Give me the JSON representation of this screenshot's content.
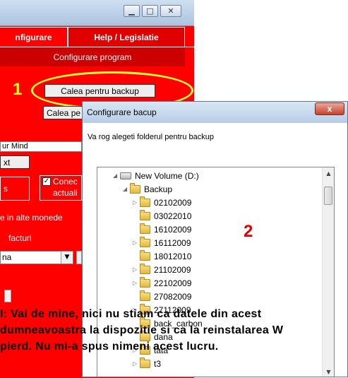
{
  "app": {
    "tabs": [
      "nfigurare",
      "Help / Legislatie"
    ],
    "config_header": "Configurare program",
    "backup_button": "Calea pentru backup",
    "backup_button_2": "Calea pe",
    "field_mind": "ur Mind",
    "btn_xt": "xt",
    "btn_s": "s",
    "checkbox_label_1": "Conec",
    "checkbox_label_2": "actuali",
    "text_monede": "e in alte monede",
    "text_facturi": "facturi",
    "select_value": "na",
    "marker": "1",
    "window_controls": [
      "minimize-icon",
      "maximize-icon",
      "close-icon"
    ]
  },
  "dialog": {
    "title": "Configurare bacup",
    "close_label": "x",
    "prompt": "Va rog alegeti folderul pentru backup",
    "marker": "2",
    "tree": {
      "root": "New Volume (D:)",
      "selected": "Backup",
      "items": [
        "02102009",
        "03022010",
        "16102009",
        "16112009",
        "18012010",
        "21102009",
        "22102009",
        "27082009",
        "27112009",
        "back_carbon",
        "dana",
        "tata",
        "t3"
      ]
    }
  },
  "comment": {
    "line1": "I: Vai de mine, nici nu stiam ca datele din acest",
    "line2": "dumneavoastra la dispozitie si ca la reinstalarea W",
    "line3": "pierd. Nu mi-a spus nimeni acest lucru."
  },
  "colors": {
    "app_red": "#ff0000",
    "marker_yellow": "#ffff00",
    "marker_red": "#e60000"
  }
}
